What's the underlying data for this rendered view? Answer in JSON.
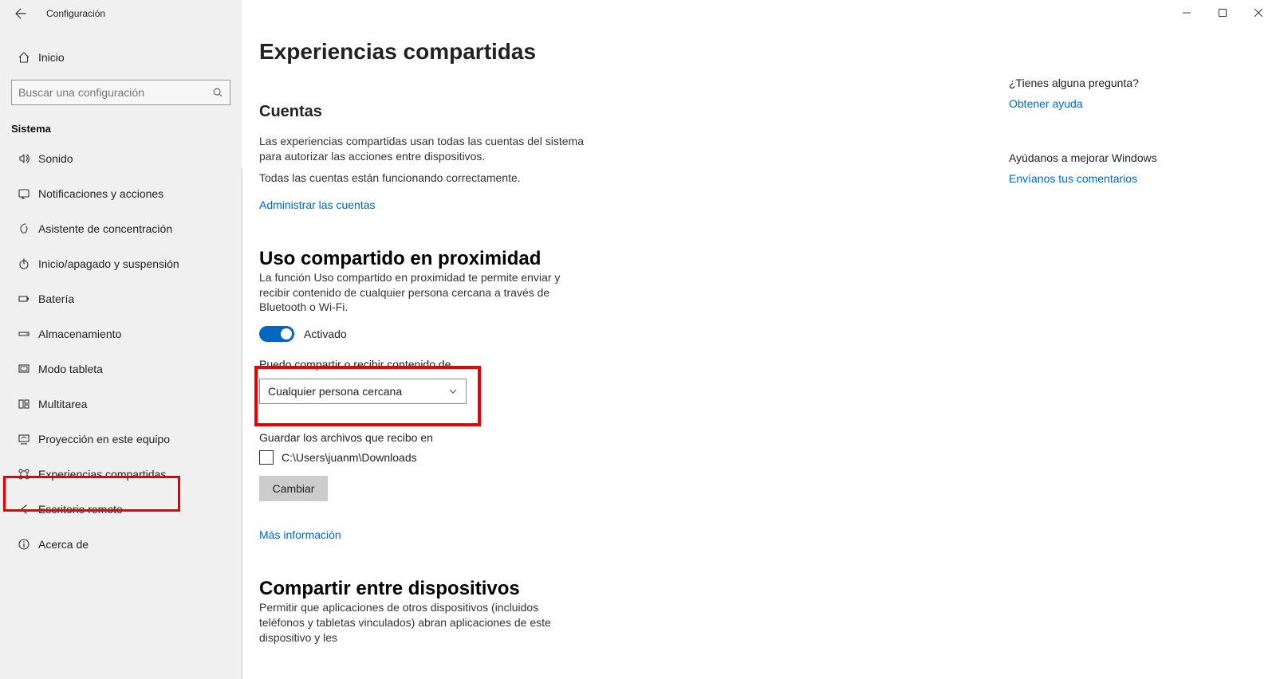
{
  "window": {
    "title": "Configuración"
  },
  "sidebar": {
    "home": "Inicio",
    "search_placeholder": "Buscar una configuración",
    "category": "Sistema",
    "items": [
      {
        "icon": "sound",
        "label": "Sonido"
      },
      {
        "icon": "notify",
        "label": "Notificaciones y acciones"
      },
      {
        "icon": "focus",
        "label": "Asistente de concentración"
      },
      {
        "icon": "power",
        "label": "Inicio/apagado y suspensión"
      },
      {
        "icon": "battery",
        "label": "Batería"
      },
      {
        "icon": "storage",
        "label": "Almacenamiento"
      },
      {
        "icon": "tablet",
        "label": "Modo tableta"
      },
      {
        "icon": "multitask",
        "label": "Multitarea"
      },
      {
        "icon": "project",
        "label": "Proyección en este equipo"
      },
      {
        "icon": "shared",
        "label": "Experiencias compartidas"
      },
      {
        "icon": "remote",
        "label": "Escritorio remoto"
      },
      {
        "icon": "about",
        "label": "Acerca de"
      }
    ]
  },
  "page": {
    "title": "Experiencias compartidas",
    "accounts": {
      "heading": "Cuentas",
      "p1": "Las experiencias compartidas usan todas las cuentas del sistema para autorizar las acciones entre dispositivos.",
      "p2": "Todas las cuentas están funcionando correctamente.",
      "manage_link": "Administrar las cuentas"
    },
    "nearby": {
      "heading": "Uso compartido en proximidad",
      "p1": "La función Uso compartido en proximidad te permite enviar y recibir contenido de cualquier persona cercana a través de Bluetooth o Wi-Fi.",
      "toggle_state": "Activado",
      "share_from_label": "Puedo compartir o recibir contenido de",
      "dropdown_value": "Cualquier persona cercana",
      "save_label": "Guardar los archivos que recibo en",
      "save_path": "C:\\Users\\juanm\\Downloads",
      "change_btn": "Cambiar",
      "more_link": "Más información"
    },
    "devices": {
      "heading": "Compartir entre dispositivos",
      "p1": "Permitir que aplicaciones de otros dispositivos (incluidos teléfonos y tabletas vinculados) abran aplicaciones de este dispositivo y les"
    }
  },
  "right": {
    "q_title": "¿Tienes alguna pregunta?",
    "q_link": "Obtener ayuda",
    "f_title": "Ayúdanos a mejorar Windows",
    "f_link": "Envíanos tus comentarios"
  }
}
